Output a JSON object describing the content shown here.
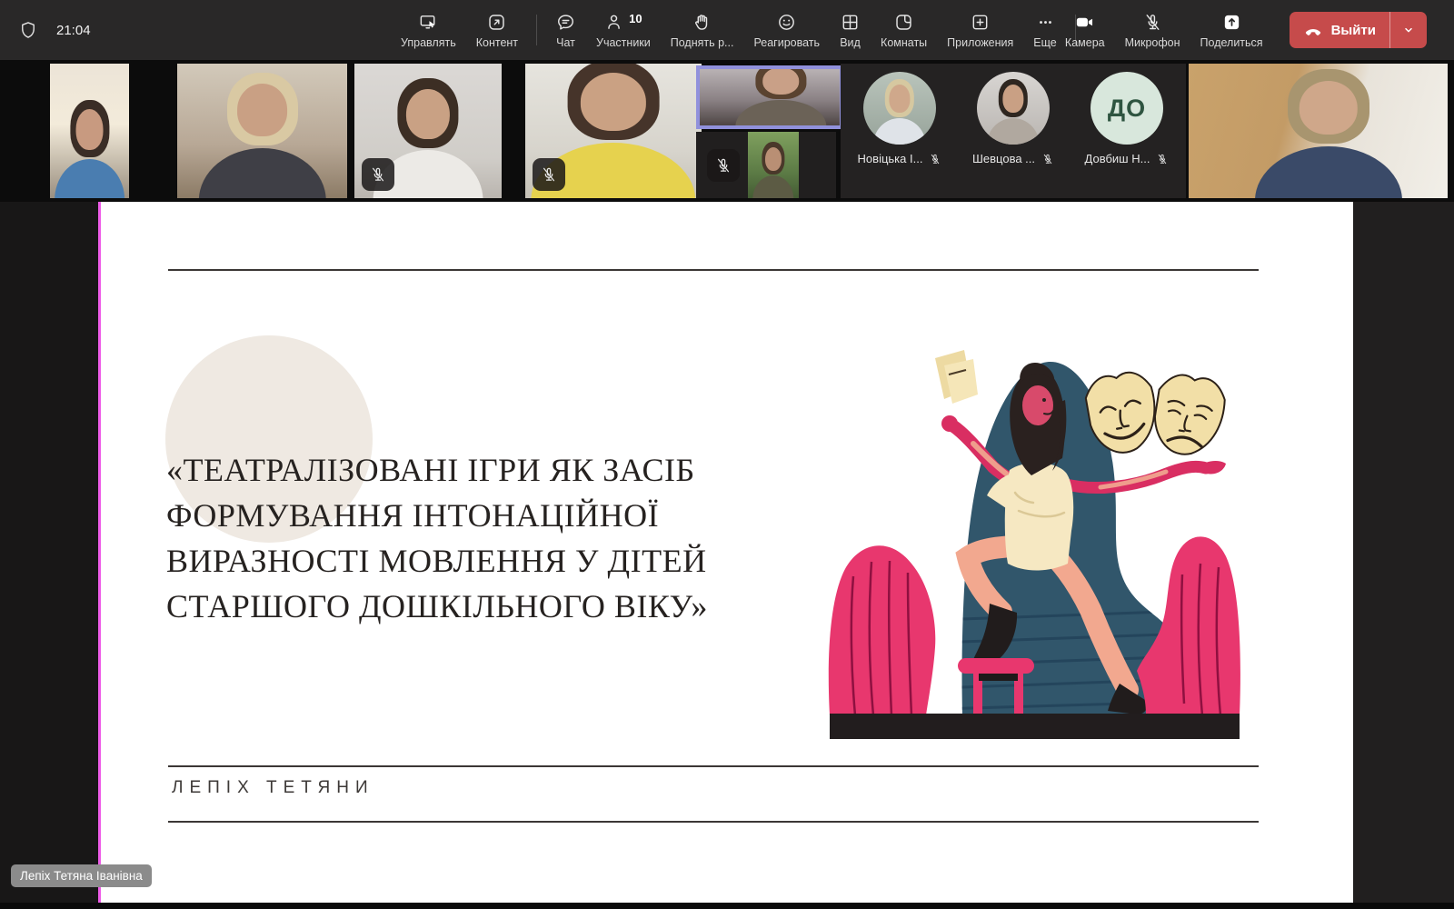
{
  "header": {
    "time": "21:04",
    "buttons": {
      "manage": "Управлять",
      "content": "Контент",
      "chat": "Чат",
      "participants": "Участники",
      "participants_count": "10",
      "raise_hand": "Поднять р...",
      "react": "Реагировать",
      "view": "Вид",
      "rooms": "Комнаты",
      "apps": "Приложения",
      "more": "Еще",
      "camera": "Камера",
      "microphone": "Микрофон",
      "share": "Поделиться",
      "leave": "Выйти"
    }
  },
  "strip": {
    "avatars": [
      {
        "label": "Новіцька І...",
        "type": "photo"
      },
      {
        "label": "Шевцова ...",
        "type": "photo"
      },
      {
        "label": "Довбиш Н...",
        "type": "initials",
        "initials": "ДО"
      }
    ]
  },
  "slide": {
    "title_lines": [
      "«ТЕАТРАЛІЗОВАНІ ІГРИ ЯК ЗАСІБ",
      "ФОРМУВАННЯ ІНТОНАЦІЙНОЇ",
      "ВИРАЗНОСТІ МОВЛЕННЯ У ДІТЕЙ",
      "СТАРШОГО ДОШКІЛЬНОГО ВІКУ»"
    ],
    "presenter": "ЛЕПІХ ТЕТЯНИ"
  },
  "overlay": {
    "presenter_tooltip": "Лепіх Тетяна Іванівна"
  },
  "colors": {
    "toolbar_bg": "#292828",
    "leave_red": "#c64b4b",
    "active_speaker_border": "#9191dc",
    "share_border_pink": "#ee5ce8",
    "initials_avatar_bg": "#d8e7dc",
    "initials_avatar_text": "#2e5440"
  }
}
